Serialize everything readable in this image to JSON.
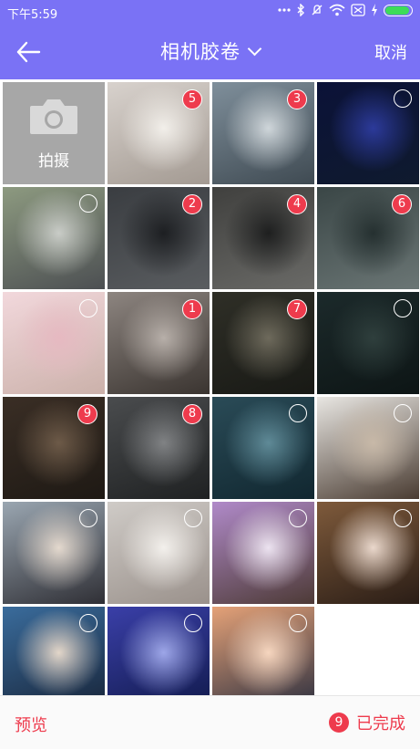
{
  "status": {
    "time": "下午5:59",
    "battery_level": 0.95,
    "icons": [
      "dots-icon",
      "bluetooth-icon",
      "silent-icon",
      "wifi-icon",
      "sim-icon",
      "charging-icon",
      "battery-icon"
    ]
  },
  "header": {
    "title": "相机胶卷",
    "cancel": "取消",
    "back_icon": "back-arrow-icon",
    "title_icon": "chevron-down-icon"
  },
  "camera": {
    "label": "拍摄",
    "icon": "camera-icon"
  },
  "photos": [
    {
      "name": "photo-woman-profile-white",
      "selected": "5",
      "colors": [
        "#d8d2cd",
        "#f2efea",
        "#a39a92"
      ]
    },
    {
      "name": "photo-woman-sea",
      "selected": "3",
      "colors": [
        "#7f8f9b",
        "#cfd6da",
        "#3f4a52"
      ]
    },
    {
      "name": "photo-starry-night",
      "selected": "",
      "colors": [
        "#0b1238",
        "#2c3a9a",
        "#0f1a2e"
      ]
    },
    {
      "name": "photo-silver-sportscar",
      "selected": "",
      "colors": [
        "#8d9a80",
        "#c9ccc7",
        "#4c4f52"
      ]
    },
    {
      "name": "photo-black-sportscar",
      "selected": "2",
      "colors": [
        "#3a3d41",
        "#1d1f22",
        "#5a5d60"
      ]
    },
    {
      "name": "photo-car-open-doors",
      "selected": "4",
      "colors": [
        "#40403e",
        "#1e1f1f",
        "#6a6a67"
      ]
    },
    {
      "name": "photo-woman-dark-room",
      "selected": "6",
      "colors": [
        "#3a4646",
        "#253030",
        "#6b7675"
      ]
    },
    {
      "name": "photo-woman-pink-magazine",
      "selected": "",
      "colors": [
        "#f2d8dc",
        "#e6b9c1",
        "#cbb1aa"
      ]
    },
    {
      "name": "photo-woman-sofa",
      "selected": "1",
      "colors": [
        "#8d8580",
        "#b7afa9",
        "#3a3430"
      ]
    },
    {
      "name": "photo-pirates-crew",
      "selected": "7",
      "colors": [
        "#2f2f27",
        "#6e6a5c",
        "#181915"
      ]
    },
    {
      "name": "photo-dark-forest",
      "selected": "",
      "colors": [
        "#1c2a2b",
        "#2f3f3d",
        "#0d1515"
      ]
    },
    {
      "name": "photo-pirate-captain",
      "selected": "9",
      "colors": [
        "#3a2e25",
        "#6d5a48",
        "#1e1914"
      ]
    },
    {
      "name": "photo-pirates-poster",
      "selected": "8",
      "colors": [
        "#4a4c4e",
        "#808284",
        "#1f2122"
      ]
    },
    {
      "name": "photo-pirates-teal",
      "selected": "",
      "colors": [
        "#2a4b57",
        "#5f8a97",
        "#112730"
      ]
    },
    {
      "name": "photo-woman-portrait-light",
      "selected": "",
      "colors": [
        "#e8e6e2",
        "#c8b9a8",
        "#4a3c32"
      ]
    },
    {
      "name": "photo-woman-event",
      "selected": "",
      "colors": [
        "#9aa6b1",
        "#e4d9ce",
        "#2f2f35"
      ]
    },
    {
      "name": "photo-woman-profile-bright",
      "selected": "",
      "colors": [
        "#cfcbc7",
        "#f3f0ec",
        "#9a918b"
      ]
    },
    {
      "name": "photo-woman-smile-purple",
      "selected": "",
      "colors": [
        "#b08ac9",
        "#ece3f0",
        "#4d3a36"
      ]
    },
    {
      "name": "photo-woman-wood-wall",
      "selected": "",
      "colors": [
        "#7e5a3b",
        "#ead8cc",
        "#2a1d16"
      ]
    },
    {
      "name": "photo-two-women-stage",
      "selected": "",
      "colors": [
        "#3a6c9c",
        "#e3d6c9",
        "#18253a"
      ]
    },
    {
      "name": "photo-couple-dance-blue",
      "selected": "",
      "colors": [
        "#3a3fa8",
        "#9da6e8",
        "#111a4c"
      ]
    },
    {
      "name": "photo-clocktower-sunset",
      "selected": "",
      "colors": [
        "#e5a278",
        "#f6d6bf",
        "#2c2f3f"
      ]
    }
  ],
  "footer": {
    "preview": "预览",
    "count": "9",
    "done": "已完成"
  }
}
